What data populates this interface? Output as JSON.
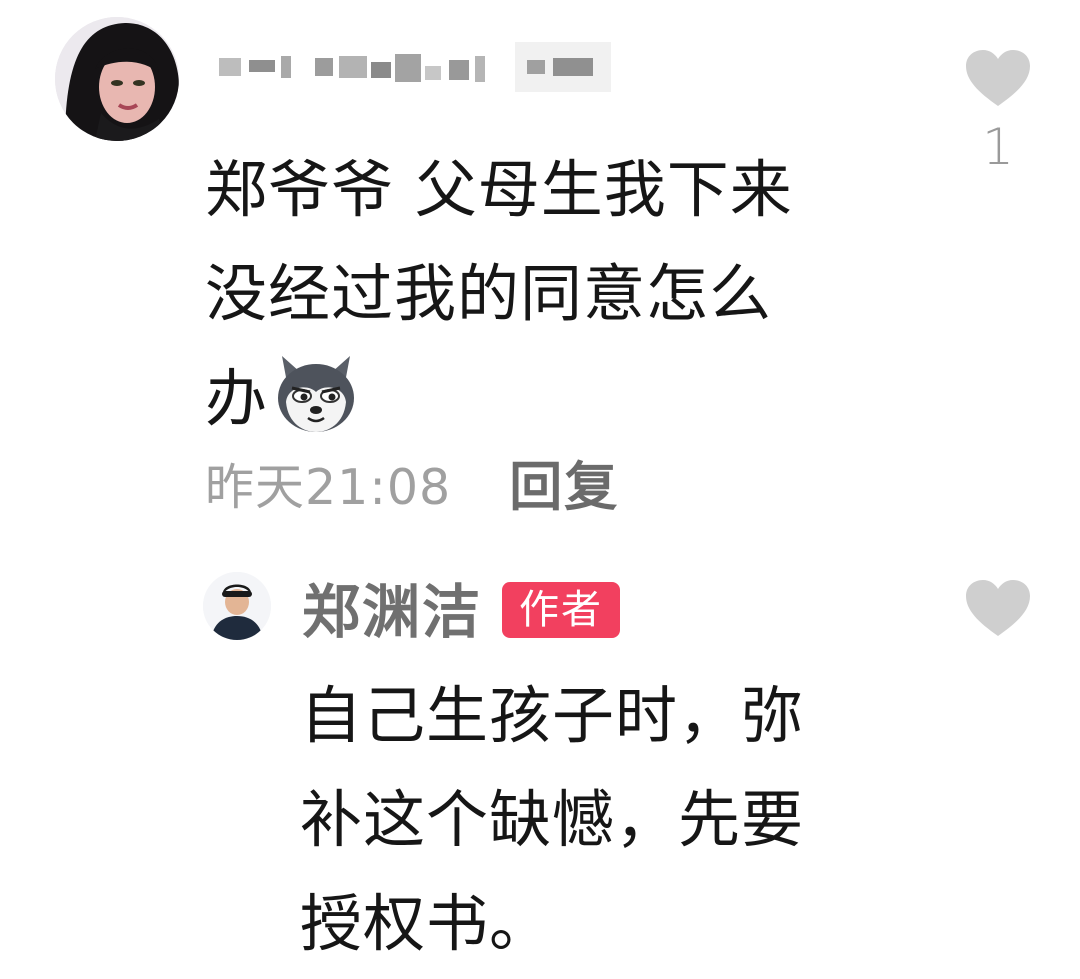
{
  "comment": {
    "username": "",
    "text": "郑爷爷 父母生我下来\n没经过我的同意怎么\n办",
    "emoji": "husky-dog-emoji",
    "timestamp": "昨天21:08",
    "reply_label": "回复",
    "like_count": "1"
  },
  "reply": {
    "username": "郑渊洁",
    "badge": "作者",
    "text": "自己生孩子时，弥\n补这个缺憾，先要\n授权书。"
  },
  "colors": {
    "badge_bg": "#f2405f",
    "heart": "#cfcfcf",
    "meta_text": "#a0a0a0"
  }
}
